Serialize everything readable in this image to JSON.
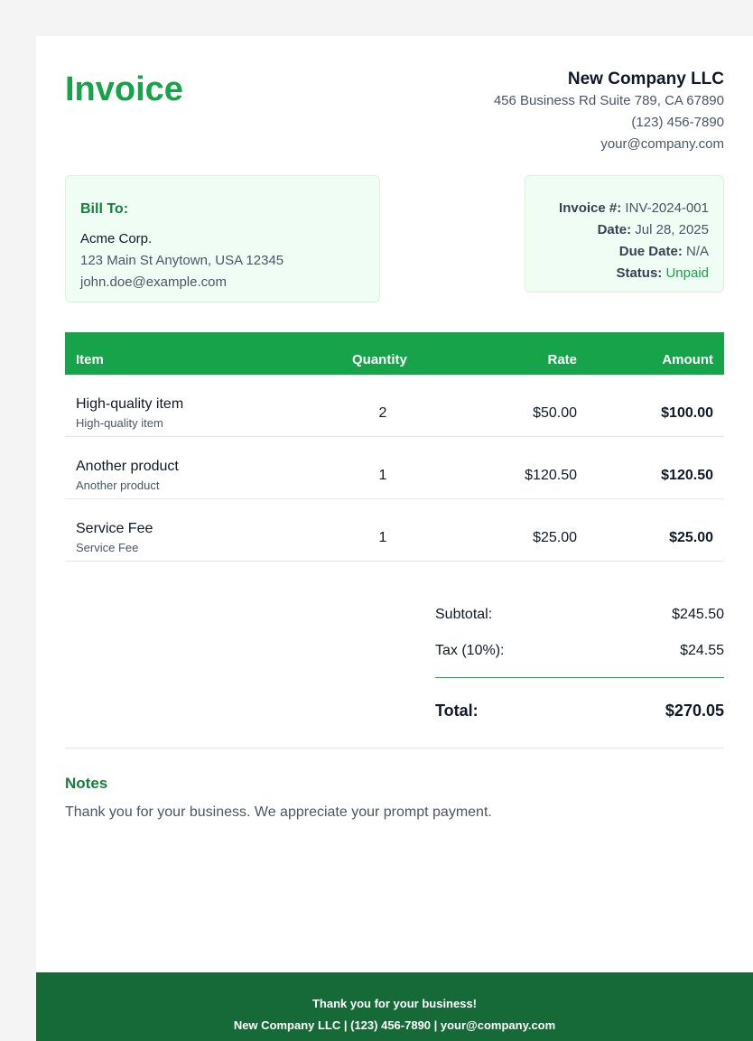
{
  "invoice": {
    "title": "Invoice",
    "company": {
      "name": "New Company LLC",
      "address": "456 Business Rd Suite 789, CA 67890",
      "phone": "(123) 456-7890",
      "email": "your@company.com"
    },
    "bill_to": {
      "heading": "Bill To:",
      "name": "Acme Corp.",
      "address": "123 Main St Anytown, USA 12345",
      "email": "john.doe@example.com"
    },
    "meta": {
      "invoice_label": "Invoice #:",
      "invoice_value": "INV-2024-001",
      "date_label": "Date:",
      "date_value": "Jul 28, 2025",
      "due_label": "Due Date:",
      "due_value": "N/A",
      "status_label": "Status:",
      "status_value": "Unpaid"
    },
    "table": {
      "headers": [
        "Item",
        "Quantity",
        "Rate",
        "Amount"
      ],
      "rows": [
        {
          "name": "High-quality item",
          "desc": "High-quality item",
          "qty": "2",
          "rate": "$50.00",
          "amount": "$100.00"
        },
        {
          "name": "Another product",
          "desc": "Another product",
          "qty": "1",
          "rate": "$120.50",
          "amount": "$120.50"
        },
        {
          "name": "Service Fee",
          "desc": "Service Fee",
          "qty": "1",
          "rate": "$25.00",
          "amount": "$25.00"
        }
      ]
    },
    "totals": {
      "subtotal_label": "Subtotal:",
      "subtotal_value": "$245.50",
      "tax_label": "Tax (10%):",
      "tax_value": "$24.55",
      "total_label": "Total:",
      "total_value": "$270.05"
    },
    "notes": {
      "title": "Notes",
      "text": "Thank you for your business. We appreciate your prompt payment."
    },
    "footer": {
      "line1": "Thank you for your business!",
      "line2": "New Company LLC | (123) 456-7890 | your@company.com"
    },
    "colors": {
      "accent": "#16a34a",
      "accent_dark": "#15803d",
      "footer_bg": "#166a37",
      "box_bg": "#effdf4"
    }
  }
}
